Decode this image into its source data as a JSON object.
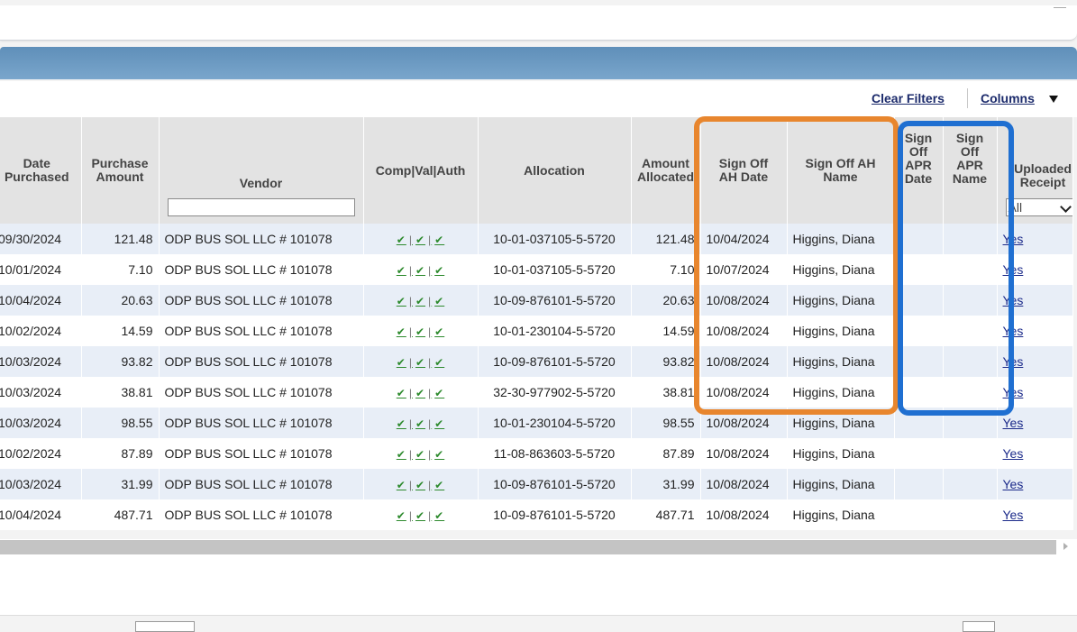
{
  "toolbar": {
    "clear_filters": "Clear Filters",
    "columns": "Columns"
  },
  "columns": {
    "date_purchased": "Date Purchased",
    "purchase_amount": "Purchase Amount",
    "vendor": "Vendor",
    "comp_val_auth": "Comp|Val|Auth",
    "allocation": "Allocation",
    "amount_allocated": "Amount Allocated",
    "sign_off_ah_date": "Sign Off AH Date",
    "sign_off_ah_name": "Sign Off AH Name",
    "sign_off_apr_date": "Sign Off APR Date",
    "sign_off_apr_name": "Sign Off APR Name",
    "uploaded_receipt": "Uploaded Receipt"
  },
  "filters": {
    "vendor_value": "",
    "receipt_selected": "All"
  },
  "cva_marks": [
    "✔",
    "|",
    "✔",
    "|",
    "✔"
  ],
  "rows": [
    {
      "date": "09/30/2024",
      "amount": "121.48",
      "vendor": "ODP BUS SOL LLC # 101078",
      "allocation": "10-01-037105-5-5720",
      "allocated": "121.48",
      "ah_date": "10/04/2024",
      "ah_name": "Higgins, Diana",
      "apr_date": "",
      "apr_name": "",
      "receipt": "Yes"
    },
    {
      "date": "10/01/2024",
      "amount": "7.10",
      "vendor": "ODP BUS SOL LLC # 101078",
      "allocation": "10-01-037105-5-5720",
      "allocated": "7.10",
      "ah_date": "10/07/2024",
      "ah_name": "Higgins, Diana",
      "apr_date": "",
      "apr_name": "",
      "receipt": "Yes"
    },
    {
      "date": "10/04/2024",
      "amount": "20.63",
      "vendor": "ODP BUS SOL LLC # 101078",
      "allocation": "10-09-876101-5-5720",
      "allocated": "20.63",
      "ah_date": "10/08/2024",
      "ah_name": "Higgins, Diana",
      "apr_date": "",
      "apr_name": "",
      "receipt": "Yes"
    },
    {
      "date": "10/02/2024",
      "amount": "14.59",
      "vendor": "ODP BUS SOL LLC # 101078",
      "allocation": "10-01-230104-5-5720",
      "allocated": "14.59",
      "ah_date": "10/08/2024",
      "ah_name": "Higgins, Diana",
      "apr_date": "",
      "apr_name": "",
      "receipt": "Yes"
    },
    {
      "date": "10/03/2024",
      "amount": "93.82",
      "vendor": "ODP BUS SOL LLC # 101078",
      "allocation": "10-09-876101-5-5720",
      "allocated": "93.82",
      "ah_date": "10/08/2024",
      "ah_name": "Higgins, Diana",
      "apr_date": "",
      "apr_name": "",
      "receipt": "Yes"
    },
    {
      "date": "10/03/2024",
      "amount": "38.81",
      "vendor": "ODP BUS SOL LLC # 101078",
      "allocation": "32-30-977902-5-5720",
      "allocated": "38.81",
      "ah_date": "10/08/2024",
      "ah_name": "Higgins, Diana",
      "apr_date": "",
      "apr_name": "",
      "receipt": "Yes"
    },
    {
      "date": "10/03/2024",
      "amount": "98.55",
      "vendor": "ODP BUS SOL LLC # 101078",
      "allocation": "10-01-230104-5-5720",
      "allocated": "98.55",
      "ah_date": "10/08/2024",
      "ah_name": "Higgins, Diana",
      "apr_date": "",
      "apr_name": "",
      "receipt": "Yes"
    },
    {
      "date": "10/02/2024",
      "amount": "87.89",
      "vendor": "ODP BUS SOL LLC # 101078",
      "allocation": "11-08-863603-5-5720",
      "allocated": "87.89",
      "ah_date": "10/08/2024",
      "ah_name": "Higgins, Diana",
      "apr_date": "",
      "apr_name": "",
      "receipt": "Yes"
    },
    {
      "date": "10/03/2024",
      "amount": "31.99",
      "vendor": "ODP BUS SOL LLC # 101078",
      "allocation": "10-09-876101-5-5720",
      "allocated": "31.99",
      "ah_date": "10/08/2024",
      "ah_name": "Higgins, Diana",
      "apr_date": "",
      "apr_name": "",
      "receipt": "Yes"
    },
    {
      "date": "10/04/2024",
      "amount": "487.71",
      "vendor": "ODP BUS SOL LLC # 101078",
      "allocation": "10-09-876101-5-5720",
      "allocated": "487.71",
      "ah_date": "10/08/2024",
      "ah_name": "Higgins, Diana",
      "apr_date": "",
      "apr_name": "",
      "receipt": "Yes"
    }
  ],
  "colors": {
    "highlight_orange": "#e8862e",
    "highlight_blue": "#1f6fd1",
    "header_band": "#6b98c2"
  }
}
